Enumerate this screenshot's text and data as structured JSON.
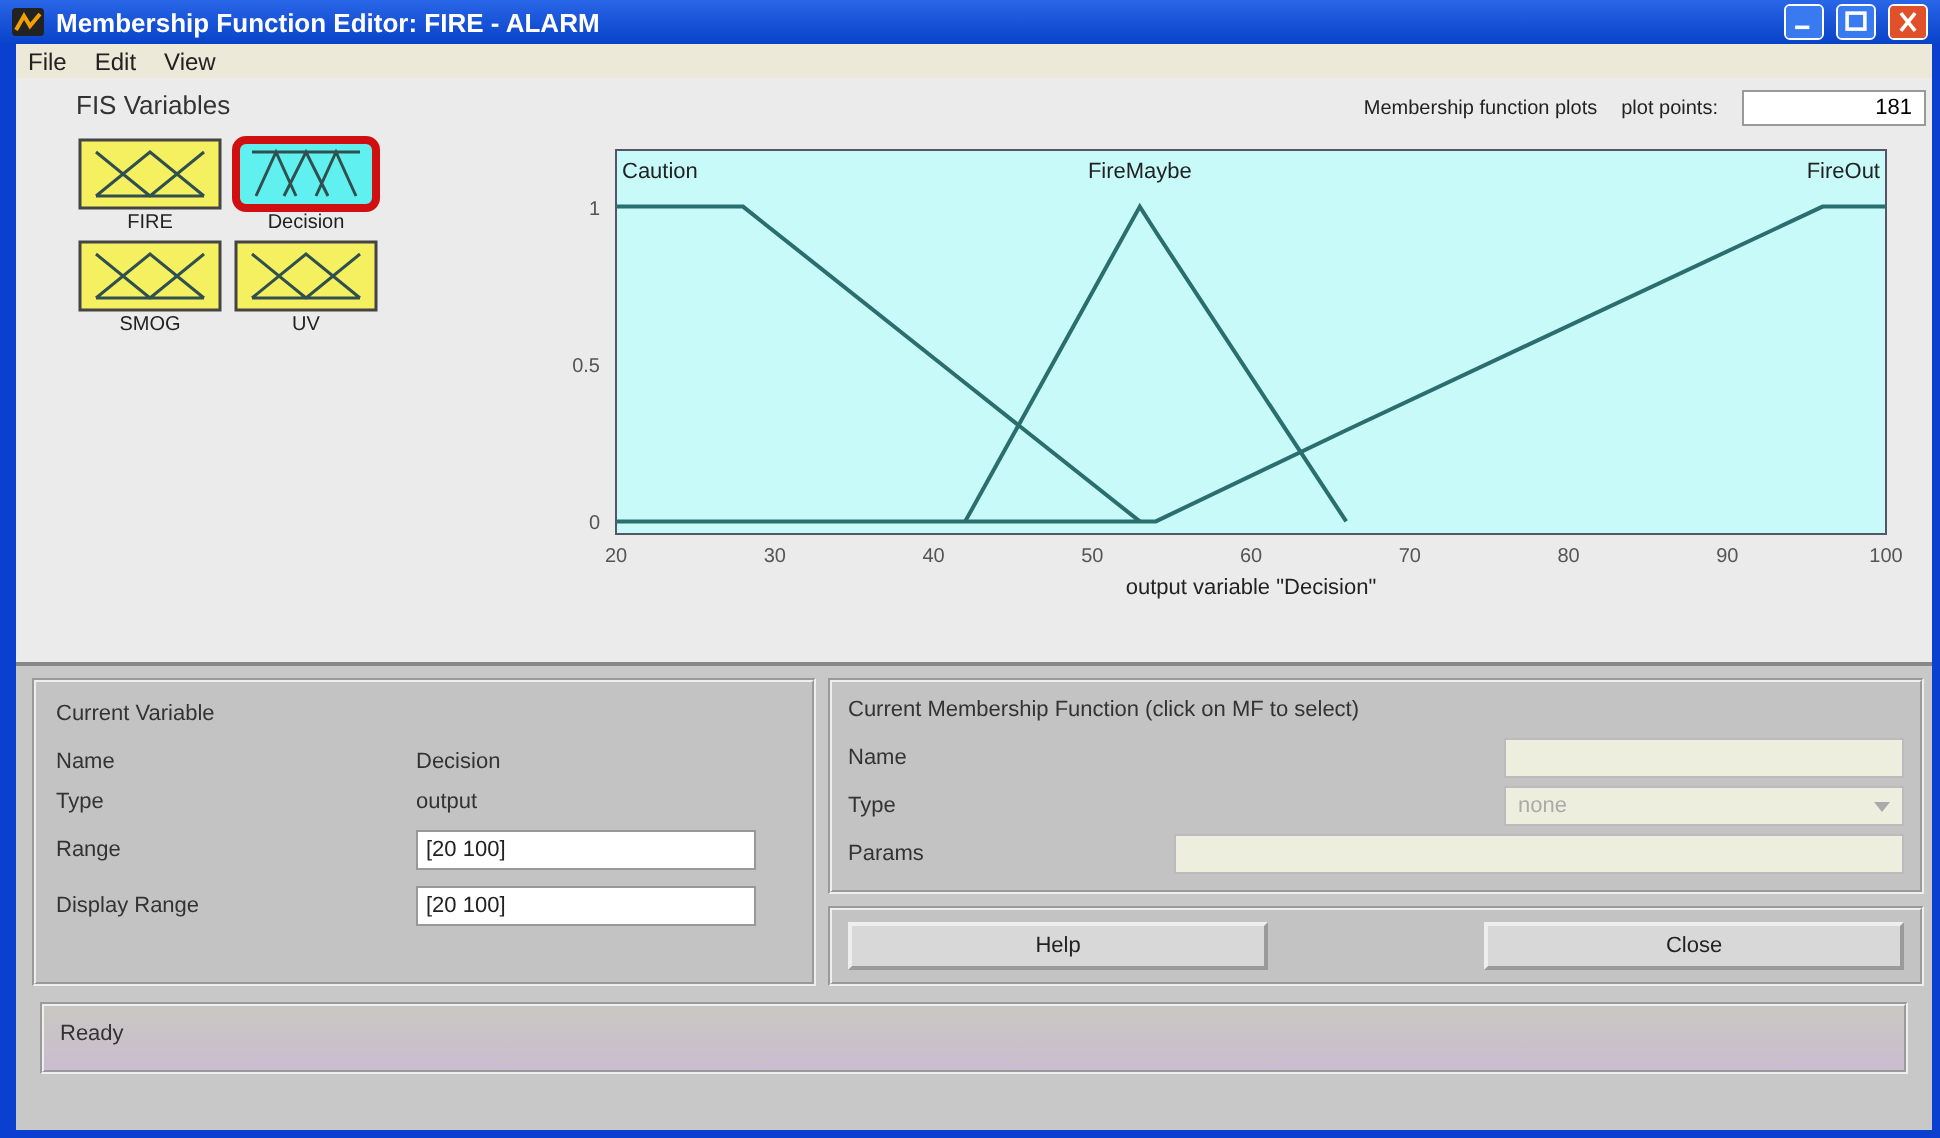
{
  "window": {
    "title": "Membership Function Editor: FIRE - ALARM"
  },
  "menu": [
    "File",
    "Edit",
    "View"
  ],
  "fis_variables": {
    "title": "FIS Variables",
    "items": [
      {
        "name": "FIRE",
        "kind": "input",
        "selected": false
      },
      {
        "name": "Decision",
        "kind": "output",
        "selected": true
      },
      {
        "name": "SMOG",
        "kind": "input",
        "selected": false
      },
      {
        "name": "UV",
        "kind": "input",
        "selected": false
      }
    ]
  },
  "plot": {
    "title": "Membership function plots",
    "plot_points_label": "plot points:",
    "plot_points": "181",
    "chart_data": {
      "type": "line",
      "xlabel": "output variable \"Decision\"",
      "x": [
        20,
        28,
        42,
        53,
        54,
        66,
        96,
        100
      ],
      "xlim": [
        20,
        100
      ],
      "ylim": [
        -0.04,
        1.18
      ],
      "xticks": [
        20,
        30,
        40,
        50,
        60,
        70,
        80,
        90,
        100
      ],
      "yticks": [
        0,
        0.5,
        1
      ],
      "series": [
        {
          "name": "Caution",
          "color": "#2a6e6e",
          "values": [
            1,
            1,
            0.44,
            0,
            null,
            null,
            null,
            null
          ]
        },
        {
          "name": "FireMaybe",
          "color": "#2a6e6e",
          "values": [
            null,
            null,
            0,
            1,
            0.92,
            0,
            null,
            null
          ]
        },
        {
          "name": "FireOut",
          "color": "#2a6e6e",
          "values": [
            0,
            0,
            0,
            0,
            0,
            0.29,
            1,
            1
          ]
        }
      ]
    }
  },
  "current_variable": {
    "title": "Current Variable",
    "name_label": "Name",
    "name": "Decision",
    "type_label": "Type",
    "type": "output",
    "range_label": "Range",
    "range": "[20 100]",
    "display_range_label": "Display Range",
    "display_range": "[20 100]"
  },
  "current_mf": {
    "title": "Current Membership Function (click on MF to select)",
    "name_label": "Name",
    "type_label": "Type",
    "type": "none",
    "params_label": "Params"
  },
  "buttons": [
    "Help",
    "Close"
  ],
  "status_bar": "Ready"
}
